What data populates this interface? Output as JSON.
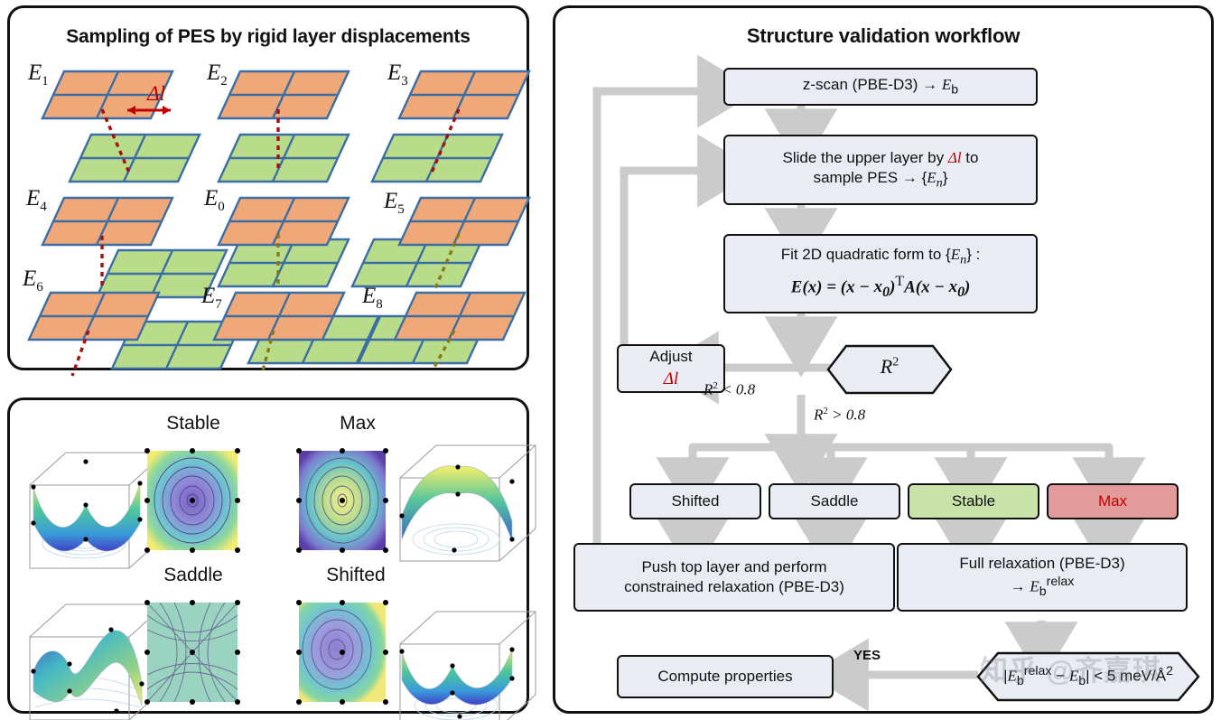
{
  "panels": {
    "sampling": {
      "title": "Sampling of PES by rigid layer displacements",
      "delta_label": "Δl",
      "energy_labels": [
        "E1",
        "E2",
        "E3",
        "E4",
        "E0",
        "E5",
        "E6",
        "E7",
        "E8"
      ],
      "colors": {
        "top_layer": "#f0a878",
        "bottom_layer": "#b8dc8a",
        "edge": "#3b6ea5",
        "dotted": "#a11212"
      }
    },
    "pes": {
      "items": [
        {
          "label": "Stable",
          "surface": "bowl-minimum"
        },
        {
          "label": "Max",
          "surface": "dome-maximum"
        },
        {
          "label": "Saddle",
          "surface": "saddle"
        },
        {
          "label": "Shifted",
          "surface": "offset-minimum"
        }
      ]
    },
    "workflow": {
      "title": "Structure validation workflow",
      "nodes": {
        "zscan": "z-scan (PBE-D3) → Eb",
        "slide_l1": "Slide the upper layer by Δl to",
        "slide_l2": "sample PES → {En}",
        "fit_l1": "Fit 2D quadratic form to {En} :",
        "fit_l2": "E(x) = (x − x0)TA(x − x0)",
        "adjust_l1": "Adjust",
        "adjust_l2": "Δl",
        "decision_r2": "R2",
        "class_shifted": "Shifted",
        "class_saddle": "Saddle",
        "class_stable": "Stable",
        "class_max": "Max",
        "push_l1": "Push top layer and perform",
        "push_l2": "constrained relaxation (PBE-D3)",
        "full_l1": "Full relaxation (PBE-D3)",
        "full_l2": "→ Ebrelax",
        "compute": "Compute properties",
        "decision_energy": "|Ebrelax − Eb| < 5 meV/Å2"
      },
      "edge_labels": {
        "r2_low": "R2 < 0.8",
        "r2_high": "R2 > 0.8",
        "yes": "YES"
      },
      "colors": {
        "node_fill": "#e9edf3",
        "stable": "#c9e3ab",
        "max": "#e39a9a",
        "arrow": "#cbcbcb",
        "accent": "#c00000"
      }
    }
  },
  "watermark": "知乎 @齐嘉琪"
}
